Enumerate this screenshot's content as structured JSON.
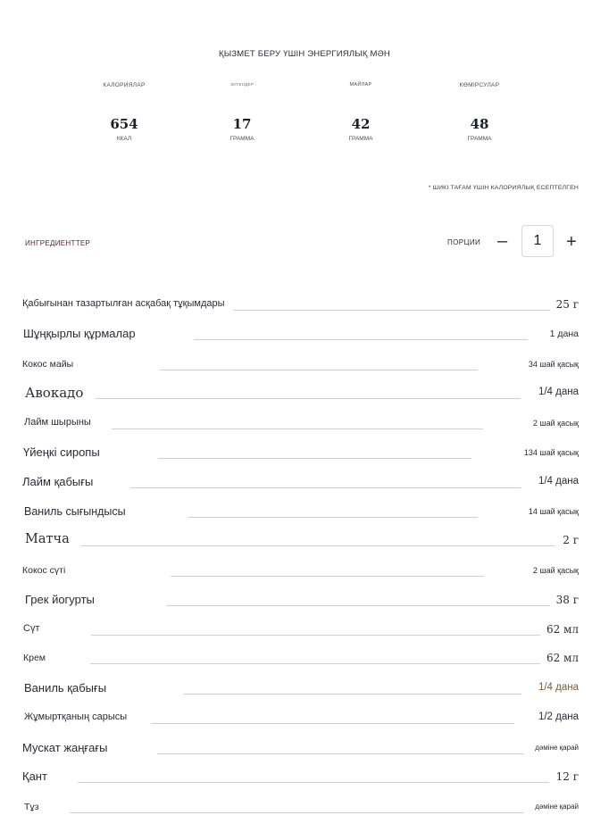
{
  "energy": {
    "title": "ҚЫЗМЕТ БЕРУ ҮШІН ЭНЕРГИЯЛЫҚ МӘН",
    "stats": [
      {
        "label": "КАЛОРИЯЛАР",
        "value": "654",
        "unit": "ККАЛ"
      },
      {
        "label": "ЭКТЕНДЕР",
        "value": "17",
        "unit": "ГРАММА"
      },
      {
        "label": "МАЙЛАР",
        "value": "42",
        "unit": "ГРАММА"
      },
      {
        "label": "КӨМІРСУЛАР",
        "value": "48",
        "unit": "ГРАММА"
      }
    ],
    "note": "* ШИКІ ТАҒАМ ҮШІН КАЛОРИЯЛЫҚ ЕСЕПТЕЛГЕН"
  },
  "ingredients": {
    "title": "ИНГРЕДИЕНТТЕР",
    "portions_label": "ПОРЦИИ",
    "portions_value": "1",
    "minus_label": "–",
    "plus_label": "+",
    "items": [
      {
        "name": "Қабығынан тазартылған асқабақ тұқымдары",
        "qty": "25 г"
      },
      {
        "name": "Шұңқырлы құрмалар",
        "qty": "1 дана"
      },
      {
        "name": "Кокос майы",
        "qty": "34 шай қасық"
      },
      {
        "name": "Авокадо",
        "qty": "1/4 дана"
      },
      {
        "name": "Лайм шырыны",
        "qty": "2 шай қасық"
      },
      {
        "name": "Үйеңкі сиропы",
        "qty": "134 шай қасық"
      },
      {
        "name": "Лайм қабығы",
        "qty": "1/4 дана"
      },
      {
        "name": "Ваниль сығындысы",
        "qty": "14 шай қасық"
      },
      {
        "name": "Матча",
        "qty": "2 г"
      },
      {
        "name": "Кокос сүті",
        "qty": "2 шай қасық"
      },
      {
        "name": "Грек йогурты",
        "qty": "38 г"
      },
      {
        "name": "Сүт",
        "qty": "62 мл"
      },
      {
        "name": "Крем",
        "qty": "62 мл"
      },
      {
        "name": "Ваниль қабығы",
        "qty": "1/4 дана"
      },
      {
        "name": "Жұмыртқаның сарысы",
        "qty": "1/2 дана"
      },
      {
        "name": "Мускат жаңғағы",
        "qty": "дәміне қарай"
      },
      {
        "name": "Қант",
        "qty": "12 г"
      },
      {
        "name": "Тұз",
        "qty": "дәміне қарай"
      }
    ]
  }
}
